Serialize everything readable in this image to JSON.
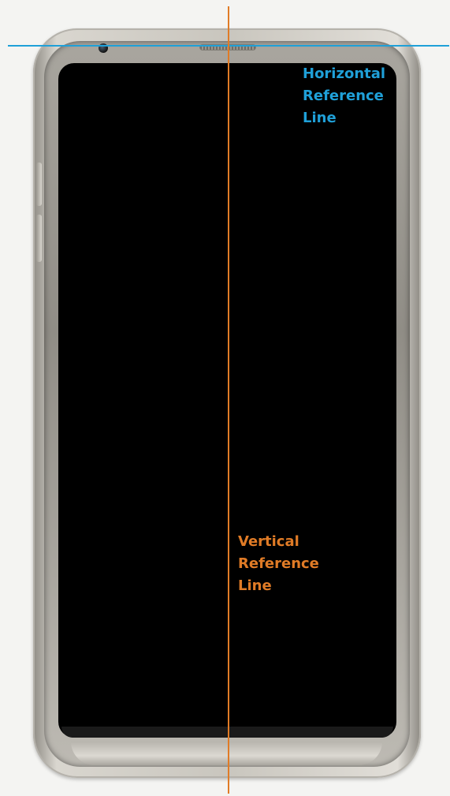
{
  "reference_lines": {
    "horizontal": {
      "label_lines": [
        "Horizontal",
        "Reference",
        "Line"
      ],
      "color": "#1fa0d8"
    },
    "vertical": {
      "label_lines": [
        "Vertical",
        "Reference",
        "Line"
      ],
      "color": "#e07b26"
    }
  },
  "photo": {
    "subject": "smartphone-front",
    "screen_color": "#000000",
    "background_color": "#f4f4f2"
  }
}
